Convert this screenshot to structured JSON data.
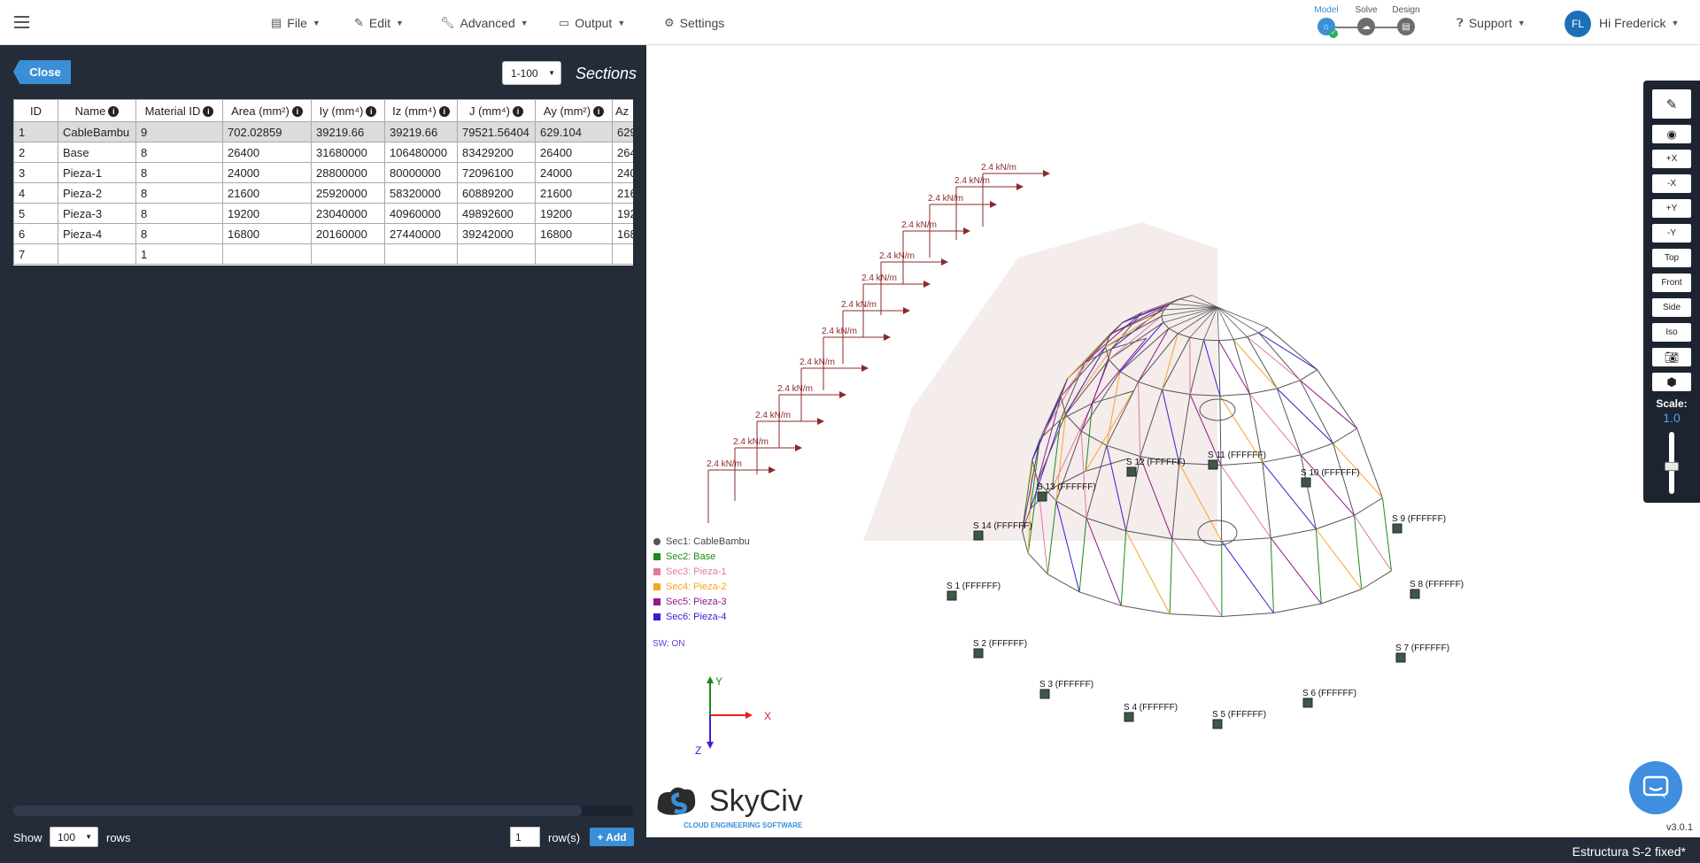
{
  "header": {
    "file": "File",
    "edit": "Edit",
    "advanced": "Advanced",
    "output": "Output",
    "settings": "Settings",
    "stages": {
      "model": "Model",
      "solve": "Solve",
      "design": "Design"
    },
    "support": "Support",
    "avatar_initials": "FL",
    "greeting": "Hi Frederick"
  },
  "sections_panel": {
    "close_label": "Close",
    "range": "1-100",
    "title": "Sections",
    "columns": [
      "ID",
      "Name",
      "Material ID",
      "Area (mm²)",
      "Iy (mm⁴)",
      "Iz (mm⁴)",
      "J (mm⁴)",
      "Ay (mm²)",
      "Az"
    ],
    "rows": [
      [
        "1",
        "CableBambu",
        "9",
        "702.02859",
        "39219.66",
        "39219.66",
        "79521.56404",
        "629.104",
        "629"
      ],
      [
        "2",
        "Base",
        "8",
        "26400",
        "31680000",
        "106480000",
        "83429200",
        "26400",
        "264"
      ],
      [
        "3",
        "Pieza-1",
        "8",
        "24000",
        "28800000",
        "80000000",
        "72096100",
        "24000",
        "240"
      ],
      [
        "4",
        "Pieza-2",
        "8",
        "21600",
        "25920000",
        "58320000",
        "60889200",
        "21600",
        "216"
      ],
      [
        "5",
        "Pieza-3",
        "8",
        "19200",
        "23040000",
        "40960000",
        "49892600",
        "19200",
        "192"
      ],
      [
        "6",
        "Pieza-4",
        "8",
        "16800",
        "20160000",
        "27440000",
        "39242000",
        "16800",
        "168"
      ],
      [
        "7",
        "",
        "1",
        "",
        "",
        "",
        "",
        "",
        ""
      ]
    ],
    "show_label": "Show",
    "show_value": "100",
    "rows_label": "rows",
    "add_count": "1",
    "add_suffix": "row(s)",
    "add_label": "+ Add"
  },
  "legend": {
    "items": [
      {
        "label": "Sec1: CableBambu",
        "color": "#555555"
      },
      {
        "label": "Sec2: Base",
        "color": "#1a8a1a"
      },
      {
        "label": "Sec3: Pieza-1",
        "color": "#e07aa0"
      },
      {
        "label": "Sec4: Pieza-2",
        "color": "#f5a623"
      },
      {
        "label": "Sec5: Pieza-3",
        "color": "#8b1a8b"
      },
      {
        "label": "Sec6: Pieza-4",
        "color": "#3a1ad4"
      }
    ],
    "sw": "SW: ON"
  },
  "axes": {
    "x": "X",
    "y": "Y",
    "z": "Z"
  },
  "load_label": "2.4 kN/m",
  "supports": [
    {
      "id": "S 1",
      "tag": "(FFFFFF)"
    },
    {
      "id": "S 2",
      "tag": "(FFFFFF)"
    },
    {
      "id": "S 3",
      "tag": "(FFFFFF)"
    },
    {
      "id": "S 4",
      "tag": "(FFFFFF)"
    },
    {
      "id": "S 5",
      "tag": "(FFFFFF)"
    },
    {
      "id": "S 6",
      "tag": "(FFFFFF)"
    },
    {
      "id": "S 7",
      "tag": "(FFFFFF)"
    },
    {
      "id": "S 8",
      "tag": "(FFFFFF)"
    },
    {
      "id": "S 9",
      "tag": "(FFFFFF)"
    },
    {
      "id": "S 10",
      "tag": "(FFFFFF)"
    },
    {
      "id": "S 11",
      "tag": "(FFFFFF)"
    },
    {
      "id": "S 12",
      "tag": "(FFFFFF)"
    },
    {
      "id": "S 13",
      "tag": "(FFFFFF)"
    },
    {
      "id": "S 14",
      "tag": "(FFFFFF)"
    }
  ],
  "toolbar": {
    "buttons": [
      "+X",
      "-X",
      "+Y",
      "-Y",
      "Top",
      "Front",
      "Side",
      "Iso"
    ],
    "scale_label": "Scale:",
    "scale_value": "1.0"
  },
  "logo": {
    "name": "SkyCiv",
    "tagline": "CLOUD ENGINEERING SOFTWARE"
  },
  "version": "v3.0.1",
  "status": "Estructura S-2 fixed*",
  "colors": {
    "accent": "#3b8fd6",
    "panel": "#242c3a",
    "load": "#8b2a2a"
  }
}
